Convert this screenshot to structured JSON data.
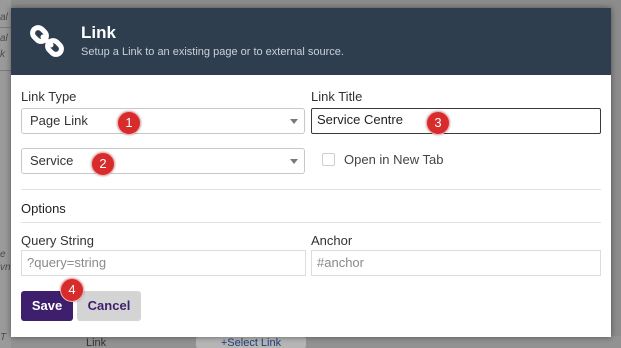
{
  "background": {
    "fragments": [
      "al",
      "al",
      "k",
      "e",
      "vn",
      "T"
    ],
    "bottom_label": "Link",
    "bottom_button": "+Select Link"
  },
  "dialog": {
    "icon": "chain-link-icon",
    "title": "Link",
    "subtitle": "Setup a Link to an existing page or to external source."
  },
  "form": {
    "link_type_label": "Link Type",
    "link_type_value": "Page Link",
    "page_value": "Service",
    "link_title_label": "Link Title",
    "link_title_value": "Service Centre",
    "open_new_tab_label": "Open in New Tab",
    "options_label": "Options",
    "query_string_label": "Query String",
    "query_string_placeholder": "?query=string",
    "anchor_label": "Anchor",
    "anchor_placeholder": "#anchor"
  },
  "buttons": {
    "save": "Save",
    "cancel": "Cancel"
  },
  "badges": [
    "1",
    "2",
    "3",
    "4"
  ],
  "colors": {
    "header_bg": "#2f3e4e",
    "save_bg": "#3d1f6e",
    "badge_bg": "#d82b2b"
  }
}
